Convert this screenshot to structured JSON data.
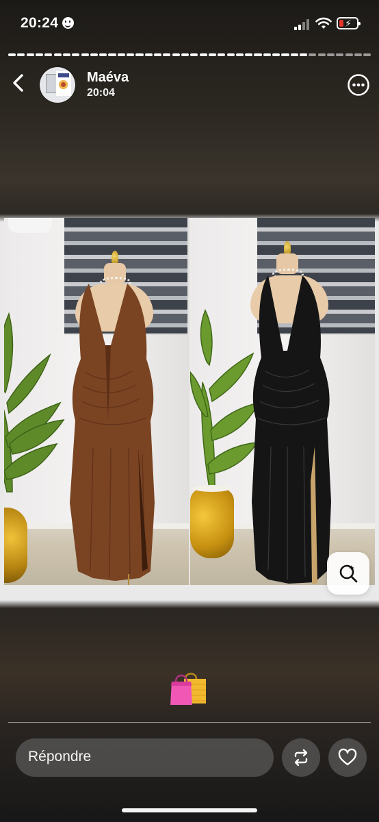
{
  "status_bar": {
    "time": "20:24",
    "icons": [
      "face-emoji-icon",
      "cellular-signal-icon",
      "wifi-icon",
      "battery-low-charging-icon"
    ],
    "battery_color": "#e5352c"
  },
  "story": {
    "progress_segments": 40,
    "progress_viewed": 33,
    "user_name": "Maéva",
    "post_time": "20:04",
    "image": {
      "description_icons": [
        "brown-halter-dress-mannequin",
        "black-halter-dress-mannequin"
      ]
    },
    "caption_emoji": "🛍️"
  },
  "footer": {
    "reply_placeholder": "Répondre",
    "icons": [
      "repost-icon",
      "heart-icon"
    ]
  }
}
